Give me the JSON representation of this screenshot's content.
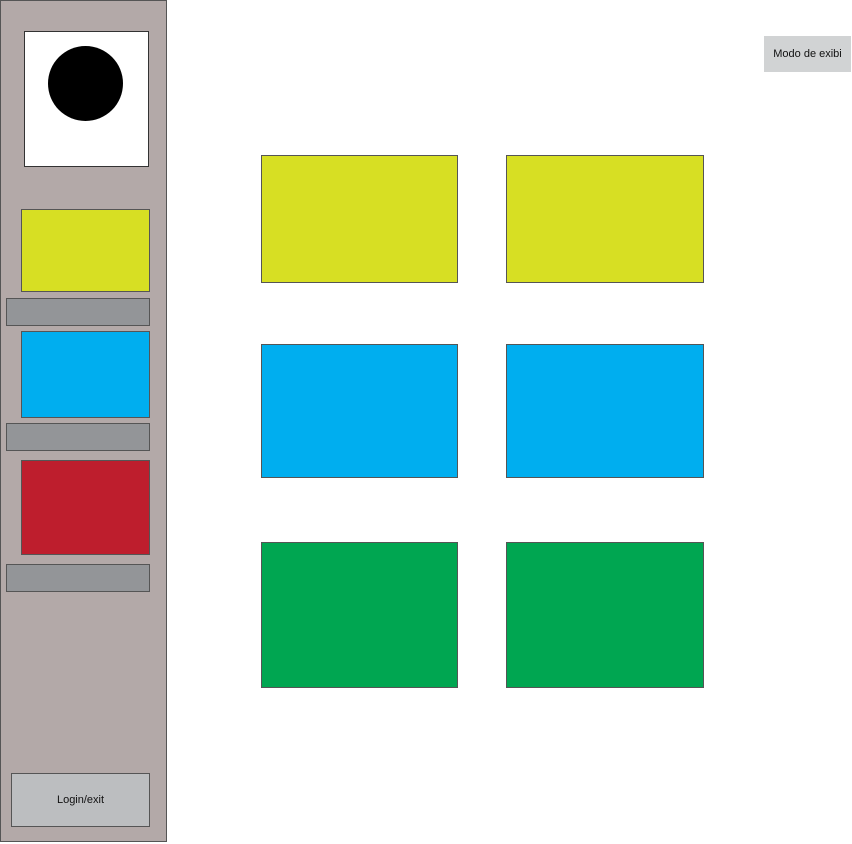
{
  "sidebar": {
    "avatar": {
      "icon": "avatar-circle-icon",
      "color": "#000000"
    },
    "items": [
      {
        "color": "#d7df23"
      },
      {
        "color": "#00aeef"
      },
      {
        "color": "#be1e2d"
      }
    ],
    "label_bar_color": "#939598",
    "login_label": "Login/exit"
  },
  "header": {
    "mode_button_label": "Modo de exibi"
  },
  "grid": {
    "rows": [
      {
        "color": "#d7df23"
      },
      {
        "color": "#00aeef"
      },
      {
        "color": "#00a651"
      }
    ]
  }
}
